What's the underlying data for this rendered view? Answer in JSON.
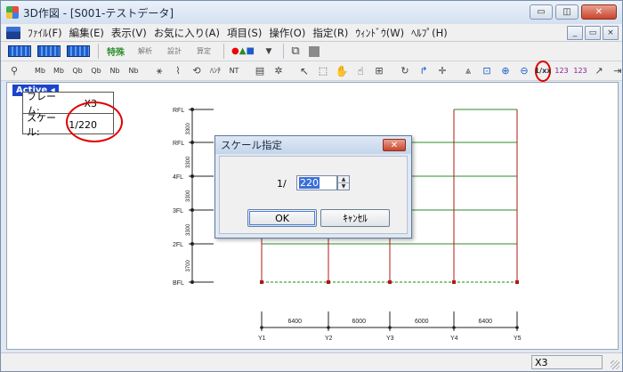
{
  "window": {
    "title": "3D作図 - [S001-テストデータ]",
    "min_glyph": "▭",
    "max_glyph": "◫",
    "close_glyph": "✕"
  },
  "mdi": {
    "min_glyph": "_",
    "restore_glyph": "▭",
    "close_glyph": "×"
  },
  "menu": {
    "items": [
      "ﾌｧｲﾙ(F)",
      "編集(E)",
      "表示(V)",
      "お気に入り(A)",
      "項目(S)",
      "操作(O)",
      "指定(R)",
      "ｳｨﾝﾄﾞｳ(W)",
      "ﾍﾙﾌﾟ(H)"
    ]
  },
  "toolbar1": {
    "labels": [
      "特殊",
      "解析",
      "設計",
      "算定"
    ]
  },
  "toolbar2": {
    "labels": [
      "Mb",
      "Mb",
      "Qb",
      "Qb",
      "Nb",
      "Nb",
      "ﾊﾝﾁ",
      "NT",
      "1/xx",
      "123",
      "123"
    ]
  },
  "canvas": {
    "active_label": "Active",
    "info": {
      "frame_label": "フレーム:",
      "frame_value": "X3",
      "scale_label": "スケール:",
      "scale_value": "1/220"
    },
    "floors": [
      "RFL",
      "RFL",
      "4FL",
      "3FL",
      "2FL",
      "BFL"
    ],
    "story_heights": [
      "3300",
      "3300",
      "3300",
      "3300",
      "3700"
    ],
    "spans": [
      "6400",
      "6000",
      "6000",
      "6400"
    ],
    "axes": [
      "Y1",
      "Y2",
      "Y3",
      "Y4",
      "Y5"
    ],
    "colors": {
      "beam": "#2e8b2e",
      "column": "#b01818",
      "base": "#1a8a1a",
      "dim": "#222222"
    }
  },
  "dialog": {
    "title": "スケール指定",
    "prefix": "1/",
    "value": "220",
    "ok_label": "OK",
    "cancel_label": "ｷｬﾝｾﾙ"
  },
  "status": {
    "frame": "X3"
  }
}
